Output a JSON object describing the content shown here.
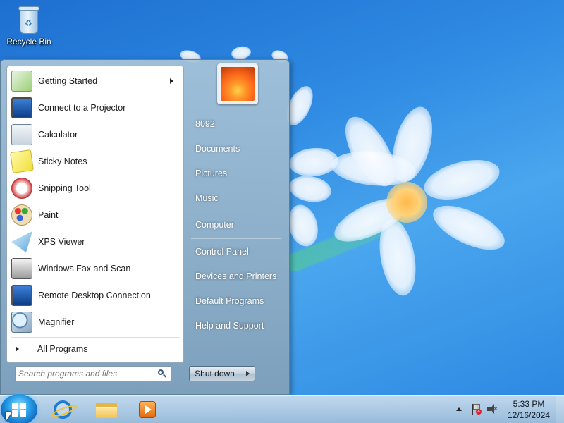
{
  "desktop": {
    "icons": [
      {
        "label": "Recycle Bin",
        "icon": "recycle-bin-icon"
      }
    ]
  },
  "start_menu": {
    "programs": [
      {
        "label": "Getting Started",
        "icon": "getting-started-icon",
        "has_submenu": true
      },
      {
        "label": "Connect to a Projector",
        "icon": "projector-icon"
      },
      {
        "label": "Calculator",
        "icon": "calculator-icon"
      },
      {
        "label": "Sticky Notes",
        "icon": "sticky-notes-icon"
      },
      {
        "label": "Snipping Tool",
        "icon": "snipping-tool-icon"
      },
      {
        "label": "Paint",
        "icon": "paint-icon"
      },
      {
        "label": "XPS Viewer",
        "icon": "xps-viewer-icon"
      },
      {
        "label": "Windows Fax and Scan",
        "icon": "fax-scan-icon"
      },
      {
        "label": "Remote Desktop Connection",
        "icon": "remote-desktop-icon"
      },
      {
        "label": "Magnifier",
        "icon": "magnifier-icon"
      }
    ],
    "all_programs_label": "All Programs",
    "search_placeholder": "Search programs and files",
    "user_name": "8092",
    "right_links": [
      {
        "label": "Documents"
      },
      {
        "label": "Pictures"
      },
      {
        "label": "Music"
      },
      {
        "label": "Computer"
      },
      {
        "label": "Control Panel"
      },
      {
        "label": "Devices and Printers"
      },
      {
        "label": "Default Programs"
      },
      {
        "label": "Help and Support"
      }
    ],
    "shutdown_label": "Shut down"
  },
  "taskbar": {
    "pinned": [
      {
        "name": "Internet Explorer",
        "icon": "internet-explorer-icon"
      },
      {
        "name": "Windows Explorer",
        "icon": "folder-icon"
      },
      {
        "name": "Windows Media Player",
        "icon": "media-player-icon"
      }
    ],
    "tray_icons": [
      "show-hidden-icons-icon",
      "action-center-flag-icon",
      "volume-muted-icon"
    ],
    "clock": {
      "time": "5:33 PM",
      "date": "12/16/2024"
    }
  },
  "colors": {
    "desktop_blue": "#2f8be3",
    "start_orb": "#2aa2ea",
    "menu_glass": "#8fb0c9"
  }
}
